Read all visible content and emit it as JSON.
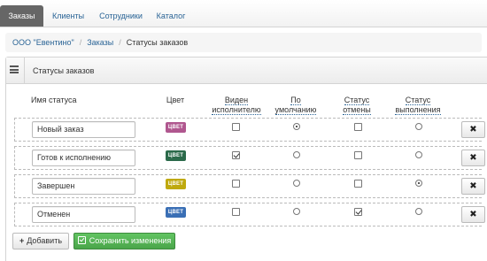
{
  "nav": {
    "tabs": [
      {
        "label": "Заказы",
        "active": true
      },
      {
        "label": "Клиенты",
        "active": false
      },
      {
        "label": "Сотрудники",
        "active": false
      },
      {
        "label": "Каталог",
        "active": false
      }
    ]
  },
  "breadcrumb": {
    "items": [
      "ООО \"Евентино\"",
      "Заказы"
    ],
    "separator": "/",
    "current": "Статусы заказов"
  },
  "panel": {
    "icon": "list-icon",
    "title": "Статусы заказов"
  },
  "columns": {
    "name": "Имя статуса",
    "color": "Цвет",
    "visible_l1": "Виден",
    "visible_l2": "исполнителю",
    "default_l1": "По",
    "default_l2": "умолчанию",
    "cancel_l1": "Статус",
    "cancel_l2": "отмены",
    "complete_l1": "Статус",
    "complete_l2": "выполнения"
  },
  "rows": [
    {
      "name": "Новый заказ",
      "color_label": "ЦВЕТ",
      "color": "#b0578f",
      "visible": false,
      "default": true,
      "cancel": false,
      "complete": false
    },
    {
      "name": "Готов к исполнению",
      "color_label": "ЦВЕТ",
      "color": "#2b6a4a",
      "visible": true,
      "default": false,
      "cancel": false,
      "complete": false
    },
    {
      "name": "Завершен",
      "color_label": "ЦВЕТ",
      "color": "#bfa90e",
      "visible": false,
      "default": false,
      "cancel": false,
      "complete": true
    },
    {
      "name": "Отменен",
      "color_label": "ЦВЕТ",
      "color": "#3a6fb5",
      "visible": false,
      "default": false,
      "cancel": true,
      "complete": false
    }
  ],
  "actions": {
    "delete_icon": "close-icon",
    "delete_glyph": "✖",
    "add_label": "Добавить",
    "add_glyph": "+",
    "save_label": "Сохранить изменения"
  },
  "colors": {
    "link": "#2a6496",
    "active_tab": "#666666",
    "save_button": "#5cb85c"
  }
}
